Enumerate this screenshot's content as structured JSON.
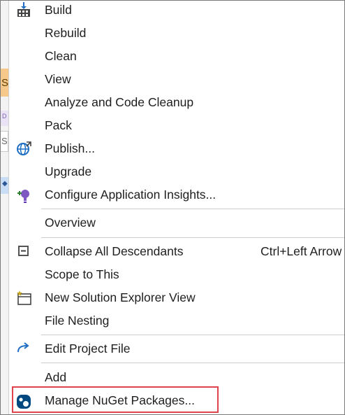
{
  "context_menu": {
    "items": [
      {
        "label": "Build",
        "icon": "build-icon"
      },
      {
        "label": "Rebuild"
      },
      {
        "label": "Clean"
      },
      {
        "label": "View"
      },
      {
        "label": "Analyze and Code Cleanup"
      },
      {
        "label": "Pack"
      },
      {
        "label": "Publish...",
        "icon": "publish-globe-icon"
      },
      {
        "label": "Upgrade"
      },
      {
        "label": "Configure Application Insights...",
        "icon": "application-insights-icon"
      },
      {
        "label": "Overview"
      },
      {
        "label": "Collapse All Descendants",
        "shortcut": "Ctrl+Left Arrow",
        "icon": "collapse-all-icon"
      },
      {
        "label": "Scope to This"
      },
      {
        "label": "New Solution Explorer View",
        "icon": "new-view-icon"
      },
      {
        "label": "File Nesting"
      },
      {
        "label": "Edit Project File",
        "icon": "edit-project-arrow-icon"
      },
      {
        "label": "Add"
      },
      {
        "label": "Manage NuGet Packages...",
        "icon": "nuget-icon"
      }
    ]
  },
  "background": {
    "orange_tab_char": "S",
    "lavender_tab_char": "D",
    "box_char": "S"
  },
  "colors": {
    "highlight_border": "#e0424e",
    "icon_blue": "#1e6fc5",
    "separator": "#cccccc"
  }
}
